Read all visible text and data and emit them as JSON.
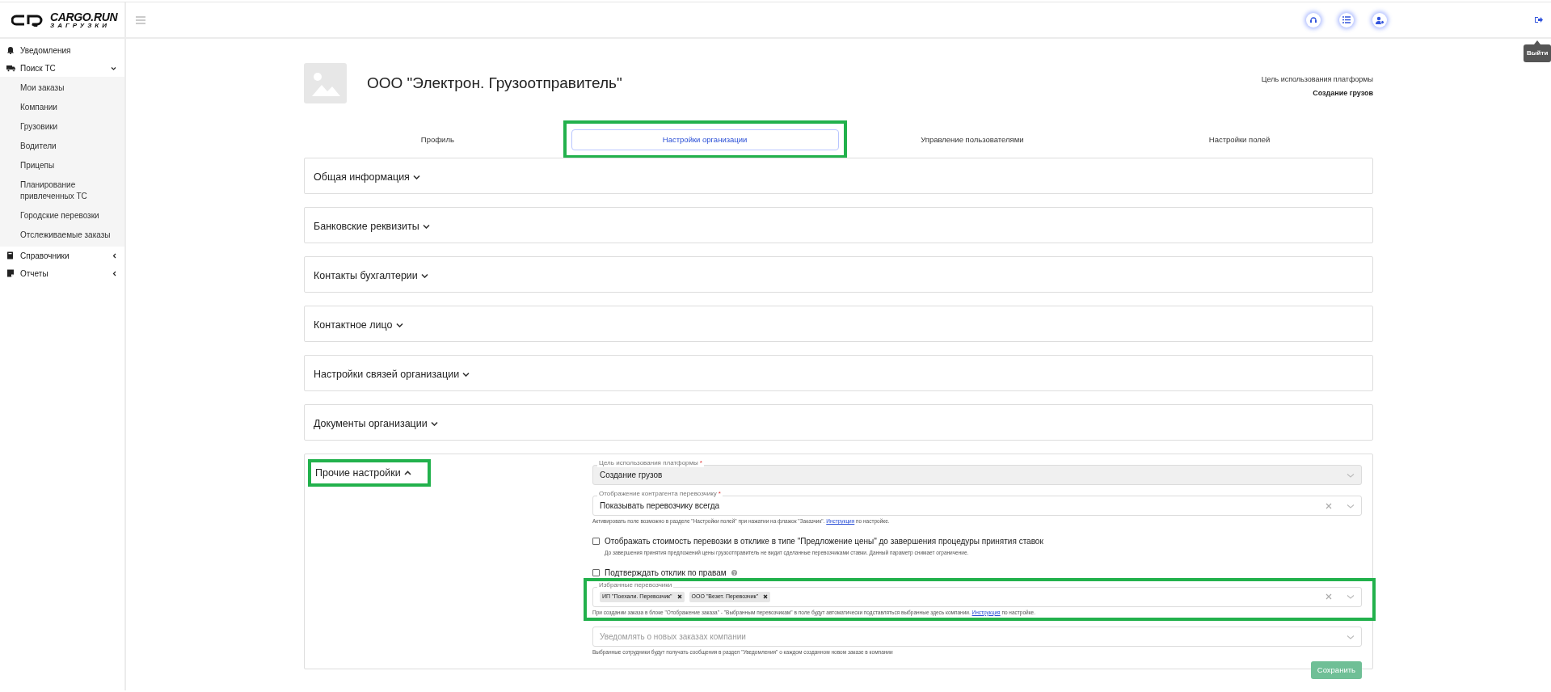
{
  "logo": {
    "name": "CARGO.RUN",
    "subtitle": "ЗАГРУЗКИ"
  },
  "header": {
    "logout_tooltip": "Выйти"
  },
  "sidebar": {
    "items": [
      {
        "label": "Уведомления",
        "kind": "bell"
      },
      {
        "label": "Поиск ТС",
        "kind": "truck",
        "expanded": true,
        "children": [
          {
            "label": "Мои заказы"
          },
          {
            "label": "Компании"
          },
          {
            "label": "Грузовики"
          },
          {
            "label": "Водители"
          },
          {
            "label": "Прицепы"
          },
          {
            "label": "Планирование привлеченных ТС"
          },
          {
            "label": "Городские перевозки"
          },
          {
            "label": "Отслеживаемые заказы"
          }
        ]
      },
      {
        "label": "Справочники",
        "kind": "book",
        "expanded": false
      },
      {
        "label": "Отчеты",
        "kind": "report",
        "expanded": false
      }
    ]
  },
  "organization": {
    "name": "ООО \"Электрон. Грузоотправитель\"",
    "purpose_label": "Цель использования платформы",
    "purpose_value": "Создание грузов"
  },
  "tabs": [
    {
      "label": "Профиль",
      "selected": false,
      "highlighted": false
    },
    {
      "label": "Настройки организации",
      "selected": true,
      "highlighted": true
    },
    {
      "label": "Управление пользователями",
      "selected": false,
      "highlighted": false
    },
    {
      "label": "Настройки полей",
      "selected": false,
      "highlighted": false
    }
  ],
  "sections": [
    {
      "title": "Общая информация",
      "expanded": false,
      "highlighted": false
    },
    {
      "title": "Банковские реквизиты",
      "expanded": false,
      "highlighted": false
    },
    {
      "title": "Контакты бухгалтерии",
      "expanded": false,
      "highlighted": false
    },
    {
      "title": "Контактное лицо",
      "expanded": false,
      "highlighted": false
    },
    {
      "title": "Настройки связей организации",
      "expanded": false,
      "highlighted": false
    },
    {
      "title": "Документы организации",
      "expanded": false,
      "highlighted": false
    },
    {
      "title": "Прочие настройки",
      "expanded": true,
      "highlighted": true
    }
  ],
  "form": {
    "fields": [
      {
        "kind": "select",
        "label": "Цель использования платформы",
        "required_mark": "*",
        "value": "Создание грузов",
        "disabled": true
      },
      {
        "kind": "select",
        "label": "Отображение контрагента перевозчику",
        "required_mark": "*",
        "value": "Показывать перевозчику всегда",
        "disabled": false,
        "clearable": true,
        "hint": "Активировать поле возможно в разделе \"Настройки полей\" при нажатии на флажок \"Заказчик\". ",
        "hint_link": "Инструкция",
        "hint_after": " по настройке."
      },
      {
        "kind": "checkbox",
        "label": "Отображать стоимость перевозки в отклике в типе \"Предложение цены\" до завершения процедуры принятия ставок",
        "checked": false,
        "hint": "До завершения принятия предложений цены грузоотправитель не видит сделанные перевозчиками ставки. Данный параметр снимает ограничение."
      },
      {
        "kind": "checkbox",
        "label": "Подтверждать отклик по правам",
        "checked": false,
        "help": true
      },
      {
        "kind": "tags",
        "label": "Избранные перевозчики",
        "tags": [
          "ИП \"Поехали. Перевозчик\"",
          "ООО \"Везет. Перевозчик\""
        ],
        "clearable": true,
        "highlighted": true,
        "hint": "При создании заказа в блоке \"Отображение заказа\" - \"Выбранным перевозчикам\" в поле будут автоматически подставляться выбранные здесь компании. ",
        "hint_link": "Инструкция",
        "hint_after": " по настройке."
      },
      {
        "kind": "select",
        "placeholder": "Уведомлять о новых заказах компании",
        "disabled": false,
        "hint": "Выбранные сотрудники будут получать сообщения в раздел \"Уведомления\" о каждом созданном новом заказе в компании"
      }
    ],
    "save_button": "Сохранить"
  }
}
